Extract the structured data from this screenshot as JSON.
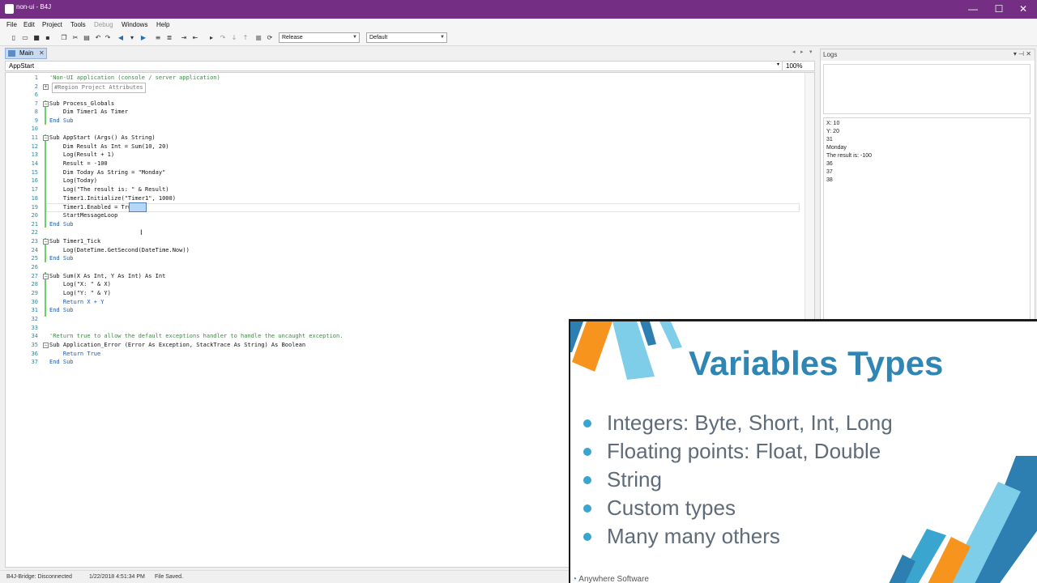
{
  "window": {
    "title": "non-ui - B4J",
    "minimize": "—",
    "maximize": "☐",
    "close": "✕"
  },
  "menu": [
    "File",
    "Edit",
    "Project",
    "Tools",
    "Debug",
    "Windows",
    "Help"
  ],
  "toolbar": {
    "build_config": "Release",
    "build_target": "Default"
  },
  "tab": {
    "label": "Main",
    "close": "✕"
  },
  "subbar": {
    "sub_name": "AppStart",
    "zoom": "100%"
  },
  "code": [
    {
      "n": "1",
      "t": "'Non-UI application (console / server application)"
    },
    {
      "n": "2",
      "t": "#Region Project Attributes"
    },
    {
      "n": "6",
      "t": ""
    },
    {
      "n": "7",
      "t": "Sub Process_Globals"
    },
    {
      "n": "8",
      "t": "    Dim Timer1 As Timer"
    },
    {
      "n": "9",
      "t": "End Sub"
    },
    {
      "n": "10",
      "t": ""
    },
    {
      "n": "11",
      "t": "Sub AppStart (Args() As String)"
    },
    {
      "n": "12",
      "t": "    Dim Result As Int = Sum(10, 20)"
    },
    {
      "n": "13",
      "t": "    Log(Result + 1)"
    },
    {
      "n": "14",
      "t": "    Result = -100"
    },
    {
      "n": "15",
      "t": "    Dim Today As String = \"Monday\""
    },
    {
      "n": "16",
      "t": "    Log(Today)"
    },
    {
      "n": "17",
      "t": "    Log(\"The result is: \" & Result)"
    },
    {
      "n": "18",
      "t": "    Timer1.Initialize(\"Timer1\", 1000)"
    },
    {
      "n": "19",
      "t": "    Timer1.Enabled = True"
    },
    {
      "n": "20",
      "t": "    StartMessageLoop"
    },
    {
      "n": "21",
      "t": "End Sub"
    },
    {
      "n": "22",
      "t": ""
    },
    {
      "n": "23",
      "t": "Sub Timer1_Tick"
    },
    {
      "n": "24",
      "t": "    Log(DateTime.GetSecond(DateTime.Now))"
    },
    {
      "n": "25",
      "t": "End Sub"
    },
    {
      "n": "26",
      "t": ""
    },
    {
      "n": "27",
      "t": "Sub Sum(X As Int, Y As Int) As Int"
    },
    {
      "n": "28",
      "t": "    Log(\"X: \" & X)"
    },
    {
      "n": "29",
      "t": "    Log(\"Y: \" & Y)"
    },
    {
      "n": "30",
      "t": "    Return X + Y"
    },
    {
      "n": "31",
      "t": "End Sub"
    },
    {
      "n": "32",
      "t": ""
    },
    {
      "n": "33",
      "t": ""
    },
    {
      "n": "34",
      "t": "'Return true to allow the default exceptions handler to handle the uncaught exception."
    },
    {
      "n": "35",
      "t": "Sub Application_Error (Error As Exception, StackTrace As String) As Boolean"
    },
    {
      "n": "36",
      "t": "    Return True"
    },
    {
      "n": "37",
      "t": "End Sub"
    }
  ],
  "logs": {
    "title": "Logs",
    "lines": [
      "X: 10",
      "Y: 20",
      "31",
      "Monday",
      "The result is: -100",
      "36",
      "37",
      "38"
    ]
  },
  "status": {
    "bridge": "B4J-Bridge: Disconnected",
    "timestamp": "1/22/2018 4:51:34 PM",
    "message": "File Saved."
  },
  "slide": {
    "title": "Variables Types",
    "bullets": [
      "Integers: Byte, Short, Int, Long",
      "Floating points: Float, Double",
      "String",
      "Custom types",
      "Many many others"
    ],
    "footer": "Anywhere Software",
    "colors": {
      "accent": "#2f86b4",
      "orange": "#f7941d",
      "light_blue": "#7ecde9",
      "dark_blue": "#2c7fb0"
    }
  }
}
